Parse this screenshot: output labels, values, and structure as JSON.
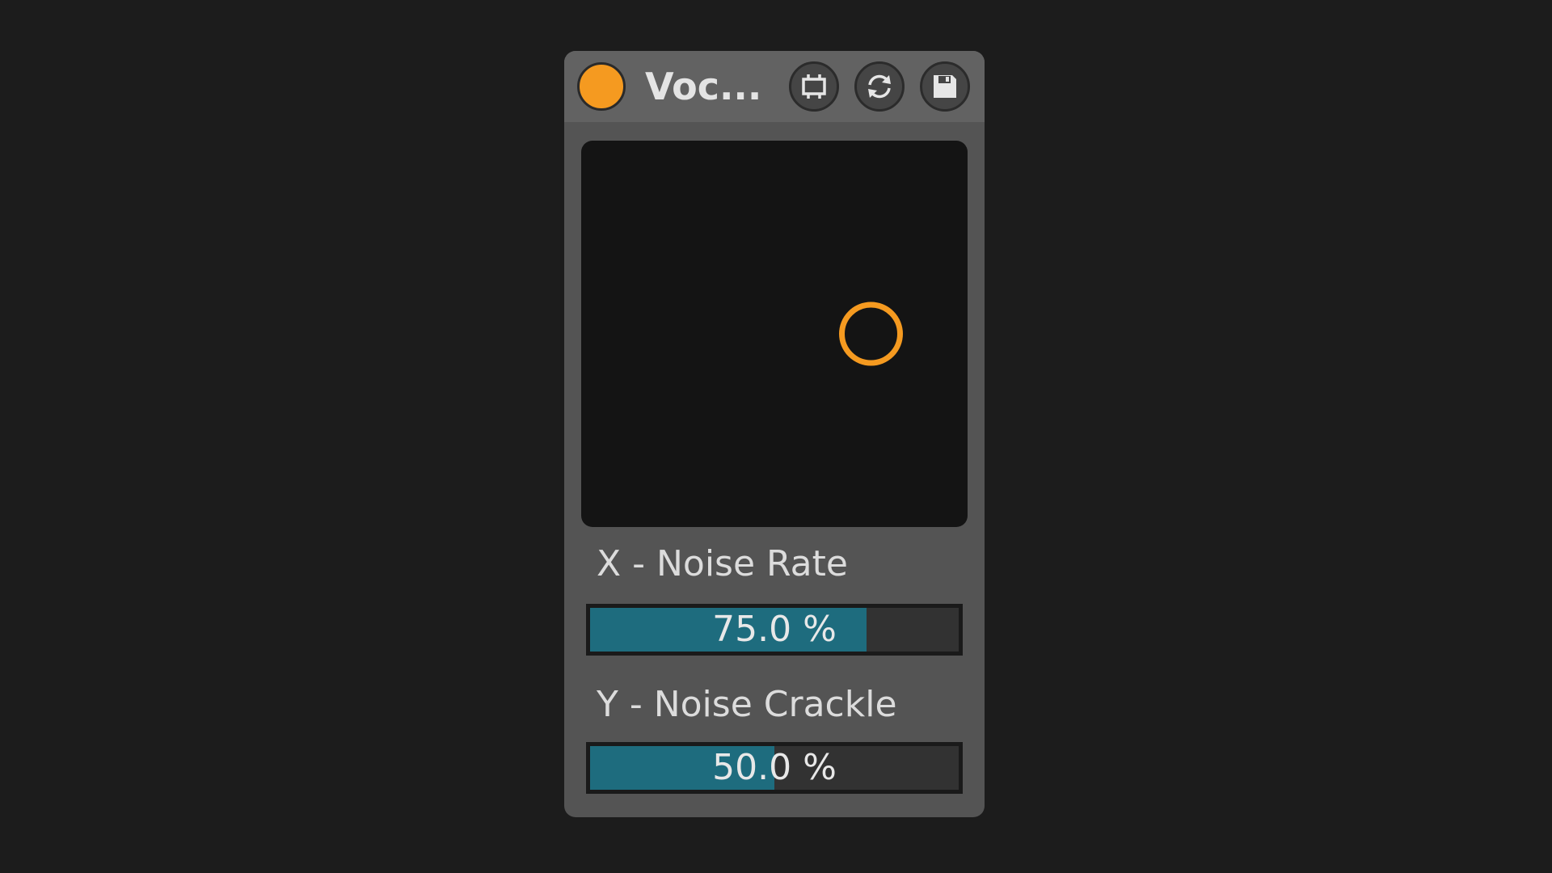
{
  "device": {
    "title": "Voc...",
    "power_on": true,
    "accent_color": "#f59a20",
    "buttons": [
      {
        "icon": "freeze-icon"
      },
      {
        "icon": "refresh-icon"
      },
      {
        "icon": "save-icon"
      }
    ]
  },
  "xy_pad": {
    "x_value": 0.75,
    "y_value": 0.5
  },
  "params": {
    "x": {
      "label": "X - Noise Rate",
      "value_text": "75.0 %",
      "value": 0.75
    },
    "y": {
      "label": "Y - Noise Crackle",
      "value_text": "50.0 %",
      "value": 0.5
    }
  },
  "colors": {
    "fill": "#1e6c7e",
    "handle": "#f59a20"
  }
}
